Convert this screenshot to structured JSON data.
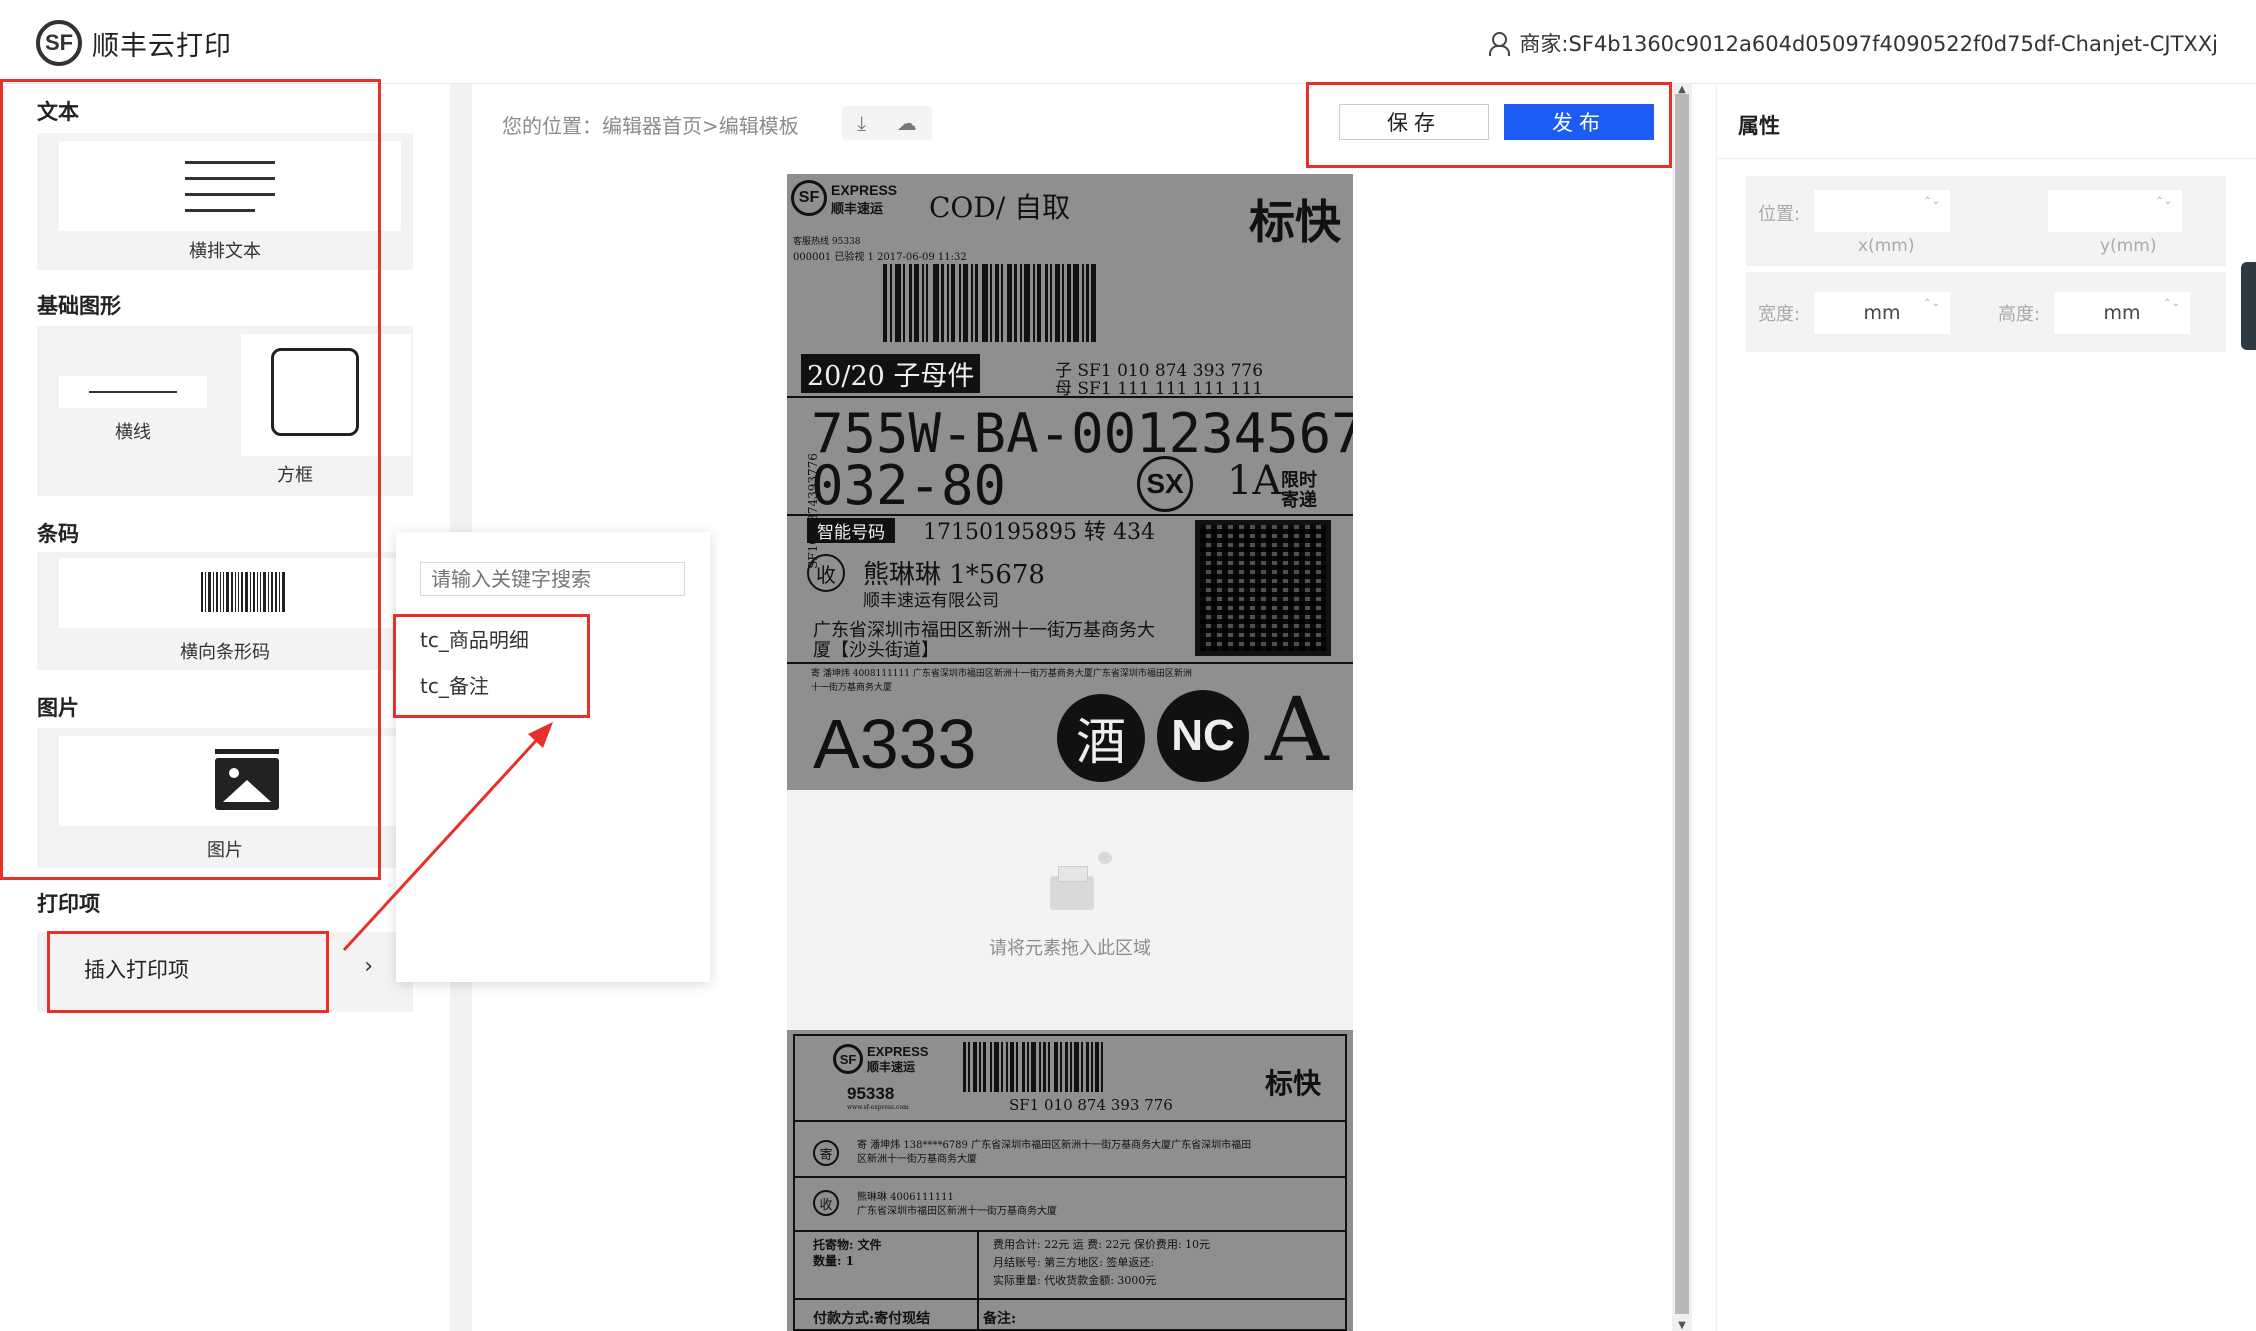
{
  "header": {
    "logo_text": "SF",
    "app_title": "顺丰云打印",
    "merchant": "商家:SF4b1360c9012a604d05097f4090522f0d75df-Chanjet-CJTXXj"
  },
  "left": {
    "sections": {
      "text": {
        "title": "文本",
        "item": "横排文本"
      },
      "shapes": {
        "title": "基础图形",
        "line": "横线",
        "box": "方框"
      },
      "barcode": {
        "title": "条码",
        "item": "横向条形码"
      },
      "image": {
        "title": "图片",
        "item": "图片"
      },
      "print": {
        "title": "打印项",
        "insert": "插入打印项",
        "chevron": "›"
      }
    }
  },
  "popup": {
    "search_placeholder": "请输入关键字搜索",
    "items": [
      "tc_商品明细",
      "tc_备注"
    ]
  },
  "toolbar": {
    "breadcrumb": "您的位置：编辑器首页>编辑模板",
    "download_icon": "⤓",
    "upload_icon": "☁",
    "save": "保存",
    "publish": "发布"
  },
  "canvas": {
    "drop_text": "请将元素拖入此区域",
    "label1": {
      "brand": "EXPRESS",
      "brand_cn": "顺丰速运",
      "cod": "COD/ 自取",
      "std": "标快",
      "hotline": "客服热线  95338",
      "line2": "000001 已验视  1   2017-06-09    11:32",
      "mother": "20/20 子母件",
      "child_no": "子 SF1  010  874  393  776",
      "mother_no": "母 SF1  111  111  111  111",
      "route": "755W-BA-001234567",
      "code2": "032-80",
      "sx": "SX",
      "oneA": "1A",
      "limit1": "限时",
      "limit2": "寄递",
      "smart": "智能号码",
      "phone": "17150195895 转 434",
      "receiver_mark": "收",
      "receiver": "熊琳琳  1*5678",
      "company": "顺丰速运有限公司",
      "addr1": "广东省深圳市福田区新洲十一街万基商务大",
      "addr2": "厦【沙头街道】",
      "sender": "寄 潘坤炜 4008111111 广东省深圳市福田区新洲十一街万基商务大厦广东省深圳市福田区新洲",
      "sender2": "十一街万基商务大厦",
      "code3": "A333",
      "wine": "酒",
      "nc": "NC",
      "a": "A",
      "side": "SF1010874393776"
    },
    "label2": {
      "brand": "EXPRESS",
      "brand_cn": "顺丰速运",
      "hotline": "95338",
      "site": "www.sf-express.com",
      "std": "标快",
      "number": "SF1  010  874  393  776",
      "send_mark": "寄",
      "send": "寄 潘坤炜  138****6789  广东省深圳市福田区新洲十一街万基商务大厦广东省深圳市福田",
      "send2": "区新洲十一街万基商务大厦",
      "recv_mark": "收",
      "recv": "熊琳琳  4006111111",
      "recv2": "广东省深圳市福田区新洲十一街万基商务大厦",
      "item": "托寄物: 文件",
      "qty": "数量: 1",
      "fee1": "费用合计: 22元    运    费: 22元     保价费用: 10元",
      "fee2": "月结账号:                第三方地区:              签单返还:",
      "fee3": "实际重量:       代收货款金额: 3000元",
      "pay": "付款方式:寄付现结",
      "note": "备注:"
    }
  },
  "properties": {
    "title": "属性",
    "position_label": "位置:",
    "x_sub": "x(mm)",
    "y_sub": "y(mm)",
    "width_label": "宽度:",
    "height_label": "高度:",
    "width_value": "mm",
    "height_value": "mm",
    "spinner": "⌃⌄"
  },
  "colors": {
    "accent": "#1d5bf5",
    "annotation": "#e8302a"
  }
}
